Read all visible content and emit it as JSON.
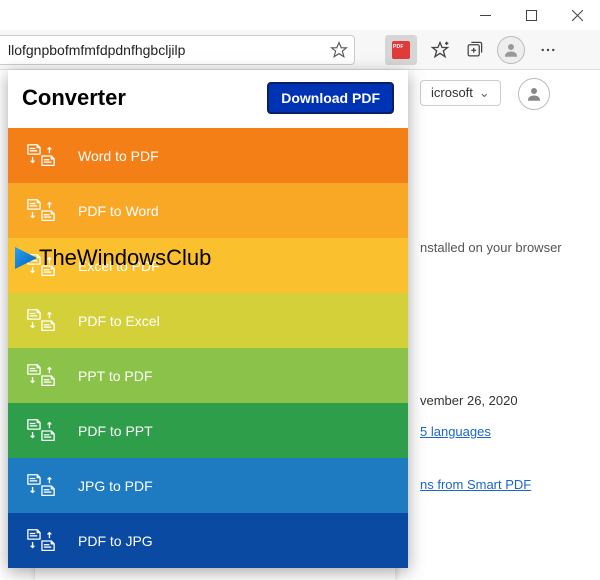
{
  "toolbar": {
    "address_value": "llofgnpbofmfmfdpdnfhgbcljilp"
  },
  "popup": {
    "title": "Converter",
    "download_label": "Download PDF",
    "rows": [
      {
        "label": "Word to PDF",
        "cls": "c-word2pdf",
        "name": "row-word-to-pdf"
      },
      {
        "label": "PDF to Word",
        "cls": "c-pdf2word",
        "name": "row-pdf-to-word"
      },
      {
        "label": "Excel to PDF",
        "cls": "c-excel2pdf",
        "name": "row-excel-to-pdf"
      },
      {
        "label": "PDF to Excel",
        "cls": "c-pdf2excel",
        "name": "row-pdf-to-excel"
      },
      {
        "label": "PPT to PDF",
        "cls": "c-ppt2pdf",
        "name": "row-ppt-to-pdf"
      },
      {
        "label": "PDF to PPT",
        "cls": "c-pdf2ppt",
        "name": "row-pdf-to-ppt"
      },
      {
        "label": "JPG to PDF",
        "cls": "c-jpg2pdf",
        "name": "row-jpg-to-pdf"
      },
      {
        "label": "PDF to JPG",
        "cls": "c-pdf2jpg",
        "name": "row-pdf-to-jpg"
      }
    ]
  },
  "watermark": {
    "text": "TheWindowsClub"
  },
  "page": {
    "tab_label": "icrosoft",
    "installed_text": "nstalled on your browser",
    "date_text": "vember 26, 2020",
    "lang_link": "5 languages",
    "vendor_link": "ns from Smart PDF"
  }
}
